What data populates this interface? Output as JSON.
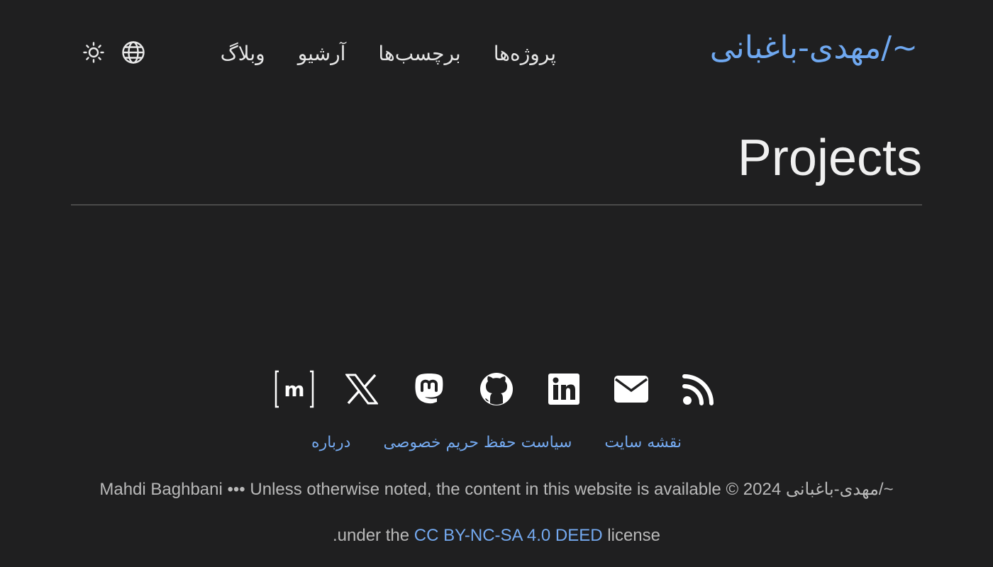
{
  "header": {
    "site_title": "~/مهدی-باغبانی",
    "nav": [
      {
        "label": "وبلاگ",
        "icon": "blog"
      },
      {
        "label": "آرشیو",
        "icon": "archive"
      },
      {
        "label": "برچسب‌ها",
        "icon": "tags"
      },
      {
        "label": "پروژه‌ها",
        "icon": "projects"
      }
    ],
    "icons": [
      "globe-icon",
      "sun-icon"
    ]
  },
  "main": {
    "title": "Projects"
  },
  "footer": {
    "social": [
      "rss-icon",
      "mail-icon",
      "linkedin-icon",
      "github-icon",
      "mastodon-icon",
      "x-icon",
      "matrix-icon"
    ],
    "links": [
      "درباره",
      "سیاست حفظ حریم خصوصی",
      "نقشه سایت"
    ],
    "copyright": {
      "site": "~/مهدی-باغبانی",
      "symbol_year": "© 2024",
      "line1_text": "is available",
      "license_prefix": "Unless otherwise noted, the content in this website",
      "author": "Mahdi Baghbani",
      "separator": "•••",
      "line2_prefix": ".under the",
      "license_link": "CC BY-NC-SA 4.0 DEED",
      "line2_suffix": "license"
    }
  },
  "colors": {
    "background": "#1f1f20",
    "accent": "#6fa8f0",
    "text": "#e6e6e6",
    "muted": "#b9b9b9"
  }
}
